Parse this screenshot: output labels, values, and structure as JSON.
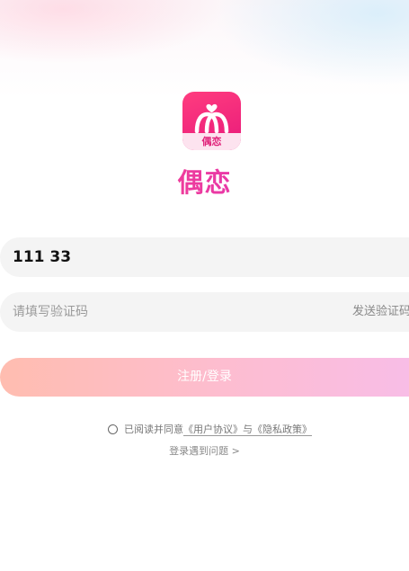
{
  "app": {
    "name": "偶恋",
    "logo_text": "偶恋",
    "brand_color": "#e8197a"
  },
  "login": {
    "phone_value": "111 33",
    "code_placeholder": "请填写验证码",
    "send_code_label": "发送验证码",
    "submit_label": "注册/登录"
  },
  "agreement": {
    "prefix": "已阅读并同意",
    "user_agreement": "《用户协议》",
    "joiner": "与",
    "privacy_policy": "《隐私政策》",
    "checked": false
  },
  "help": {
    "label": "登录遇到问题 >"
  },
  "icons": {
    "logo": "heart-rings-icon",
    "checkbox": "radio-circle-icon"
  }
}
